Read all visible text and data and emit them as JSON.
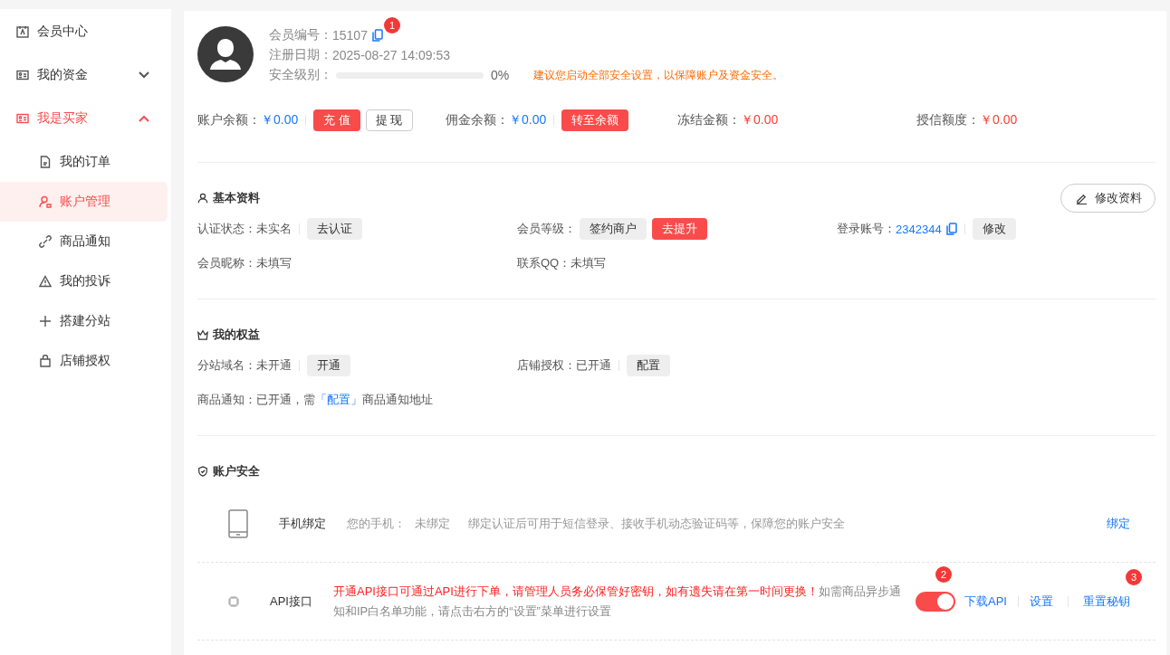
{
  "sidebar": {
    "items": [
      {
        "label": "会员中心",
        "selected": false
      },
      {
        "label": "我的资金",
        "selected": false,
        "expanded": false
      },
      {
        "label": "我是买家",
        "selected": true,
        "expanded": true,
        "children": [
          {
            "label": "我的订单",
            "selected": false
          },
          {
            "label": "账户管理",
            "selected": true
          },
          {
            "label": "商品通知",
            "selected": false
          },
          {
            "label": "我的投诉",
            "selected": false
          },
          {
            "label": "搭建分站",
            "selected": false
          },
          {
            "label": "店铺授权",
            "selected": false
          }
        ]
      }
    ]
  },
  "profile": {
    "member_no": {
      "label": "会员编号：",
      "value": "15107",
      "badge": "1"
    },
    "register_date": {
      "label": "注册日期：",
      "value": "2025-08-27 14:09:53"
    },
    "security": {
      "label": "安全级别：",
      "level": 0,
      "percent": "0%",
      "tip": "建议您启动全部安全设置，以保障账户及资金安全。"
    }
  },
  "balances": [
    {
      "label": "账户余额：",
      "value": "￥0.00",
      "color": "#1677ff",
      "buttons": [
        {
          "label": "充 值",
          "kind": "primary"
        },
        {
          "label": "提 现",
          "kind": "outline"
        }
      ]
    },
    {
      "label": "佣金余额：",
      "value": "￥0.00",
      "color": "#1677ff",
      "buttons": [
        {
          "label": "转至余额",
          "kind": "primary"
        }
      ]
    },
    {
      "label": "冻结金额：",
      "value": "￥0.00",
      "color": "#ff3b30"
    },
    {
      "label": "授信额度：",
      "value": "￥0.00",
      "color": "#ff3b30"
    }
  ],
  "basic_info": {
    "title": "基本资料",
    "edit_button": "修改资料",
    "rows": [
      [
        {
          "label": "认证状态：",
          "value": "未实名",
          "buttons": [
            {
              "label": "去认证",
              "kind": "gray"
            }
          ]
        },
        {
          "label": "会员等级：",
          "buttons": [
            {
              "label": "签约商户",
              "kind": "gray"
            },
            {
              "label": "去提升",
              "kind": "primary"
            }
          ]
        },
        {
          "label": "登录账号：",
          "value": "2342344",
          "link": true,
          "copy": true,
          "buttons": [
            {
              "label": "修改",
              "kind": "gray"
            }
          ]
        }
      ],
      [
        {
          "label": "会员昵称：",
          "value": "未填写"
        },
        {
          "label": "联系QQ：",
          "value": "未填写"
        }
      ]
    ]
  },
  "rights": {
    "title": "我的权益",
    "rows": [
      [
        {
          "label": "分站域名：",
          "value": "未开通",
          "buttons": [
            {
              "label": "开通",
              "kind": "gray"
            }
          ]
        },
        {
          "label": "店铺授权：",
          "value": "已开通",
          "buttons": [
            {
              "label": "配置",
              "kind": "gray"
            }
          ]
        }
      ]
    ],
    "notice": {
      "label": "商品通知：",
      "before": "已开通，需",
      "link": "「配置」",
      "after": "商品通知地址"
    }
  },
  "security": {
    "title": "账户安全",
    "items": [
      {
        "kind": "phone",
        "title": "手机绑定",
        "label": "您的手机：",
        "value": "未绑定",
        "desc": "绑定认证后可用于短信登录、接收手机动态验证码等，保障您的账户安全",
        "actions": [
          {
            "label": "绑定"
          }
        ]
      },
      {
        "kind": "api",
        "title": "API接口",
        "warning": "开通API接口可通过API进行下单，请管理人员务必保管好密钥，如有遗失请在第一时间更换！",
        "desc": "如需商品异步通知和IP白名单功能，请点击右方的“设置”菜单进行设置",
        "on": true,
        "toggle_badge": "2",
        "actions": [
          {
            "label": "下载API"
          },
          {
            "label": "设置"
          },
          {
            "label": "重置秘钥",
            "badge": "3"
          }
        ]
      }
    ]
  }
}
